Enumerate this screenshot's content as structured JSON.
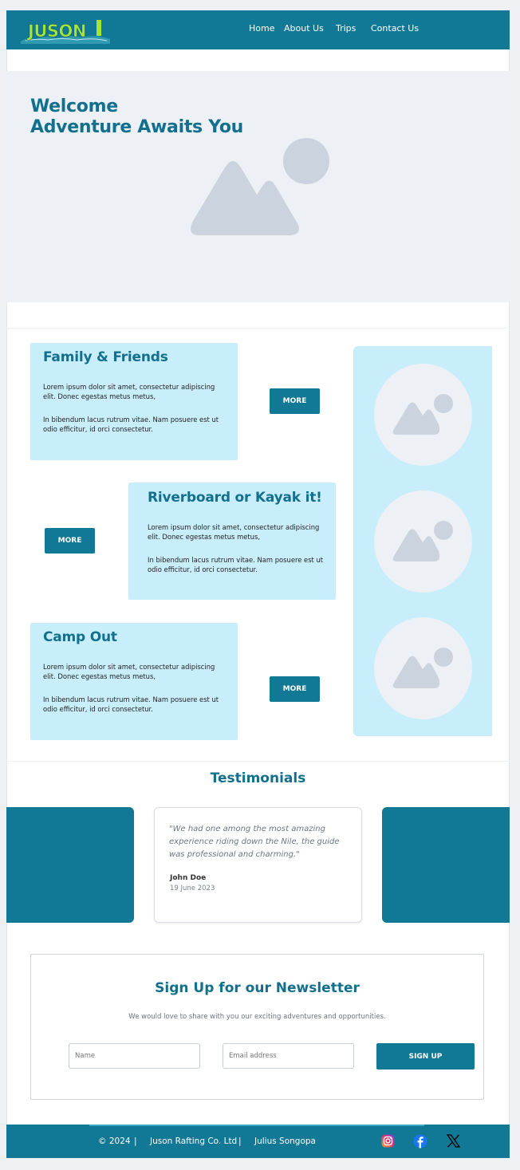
{
  "colors": {
    "brand": "#117896",
    "title": "#12708e",
    "card": "#c8eefb",
    "placeholder": "#cbd4de"
  },
  "nav": {
    "logo_text": "JUSON",
    "items": [
      "Home",
      "About Us",
      "Trips",
      "Contact Us"
    ]
  },
  "hero": {
    "line1": "Welcome",
    "line2": "Adventure Awaits You",
    "image_icon": "image-placeholder-icon"
  },
  "trips": [
    {
      "title": "Family & Friends",
      "text1": " Lorem ipsum dolor sit amet, consectetur adipiscing elit. Donec egestas metus metus,",
      "text2": "In bibendum lacus rutrum vitae.  Nam posuere est ut odio efficitur, id orci consectetur.",
      "button": "MORE"
    },
    {
      "title": "Riverboard or Kayak it!",
      "text1": " Lorem ipsum dolor sit amet, consectetur adipiscing elit. Donec egestas metus metus,",
      "text2": "In bibendum lacus rutrum vitae.  Nam posuere est ut odio efficitur, id orci consectetur.",
      "button": "MORE"
    },
    {
      "title": "Camp Out",
      "text1": " Lorem ipsum dolor sit amet, consectetur adipiscing elit. Donec egestas metus metus,",
      "text2": "In bibendum lacus rutrum vitae.  Nam posuere est ut odio efficitur, id orci consectetur.",
      "button": "MORE"
    }
  ],
  "testimonials": {
    "title": "Testimonials",
    "quote": "\"We had one among the most amazing experience riding down the Nile, the guide was professional and charming.\"",
    "name": "John Doe",
    "date": "19 June 2023"
  },
  "newsletter": {
    "title": "Sign Up for our Newsletter",
    "subtitle": "We would love to share with you our exciting adventures and opportunities.",
    "name_placeholder": "Name",
    "email_placeholder": "Email address",
    "button": "SIGN UP"
  },
  "footer": {
    "copyright": "© 2024",
    "divider": "|",
    "company": "Juson Rafting Co. Ltd",
    "author": "Julius Songopa",
    "social_icons": [
      "instagram-icon",
      "facebook-icon",
      "x-icon"
    ]
  }
}
